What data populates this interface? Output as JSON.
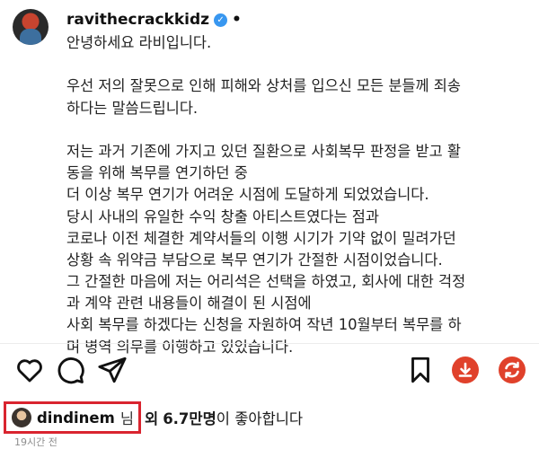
{
  "post": {
    "username": "ravithecrackkidz",
    "verified_mark": "✓",
    "separator": "•",
    "caption_lines": [
      "안녕하세요 라비입니다.",
      "",
      "우선 저의 잘못으로 인해 피해와 상처를 입으신 모든 분들께 죄송",
      "하다는 말씀드립니다.",
      "",
      "저는 과거 기존에 가지고 있던 질환으로 사회복무 판정을 받고 활",
      "동을 위해 복무를 연기하던 중",
      "더 이상 복무 연기가 어려운 시점에 도달하게 되었었습니다.",
      "당시 사내의 유일한 수익 창출 아티스트였다는 점과",
      "코로나 이전 체결한 계약서들의 이행 시기가 기약 없이 밀려가던",
      "상황 속 위약금 부담으로 복무 연기가 간절한 시점이었습니다.",
      "그 간절한 마음에 저는 어리석은 선택을 하였고, 회사에 대한 걱정",
      "과 계약 관련 내용들이 해결이 된 시점에",
      "사회 복무를 하겠다는 신청을 자원하여 작년 10월부터 복무를 하",
      "며 병역 의무를 이행하고 있었습니다."
    ]
  },
  "actions": {
    "icons": [
      "heart-icon",
      "comment-icon",
      "share-icon",
      "bookmark-icon",
      "download-icon",
      "refresh-icon"
    ],
    "accent_color": "#e0412b"
  },
  "likes": {
    "liker_name": "dindinem",
    "liker_suffix": "님",
    "mid_text": "외",
    "count": "6.7만명",
    "tail_text": "이 좋아합니다",
    "highlight_color": "#d9242f"
  },
  "timestamp": "19시간 전"
}
